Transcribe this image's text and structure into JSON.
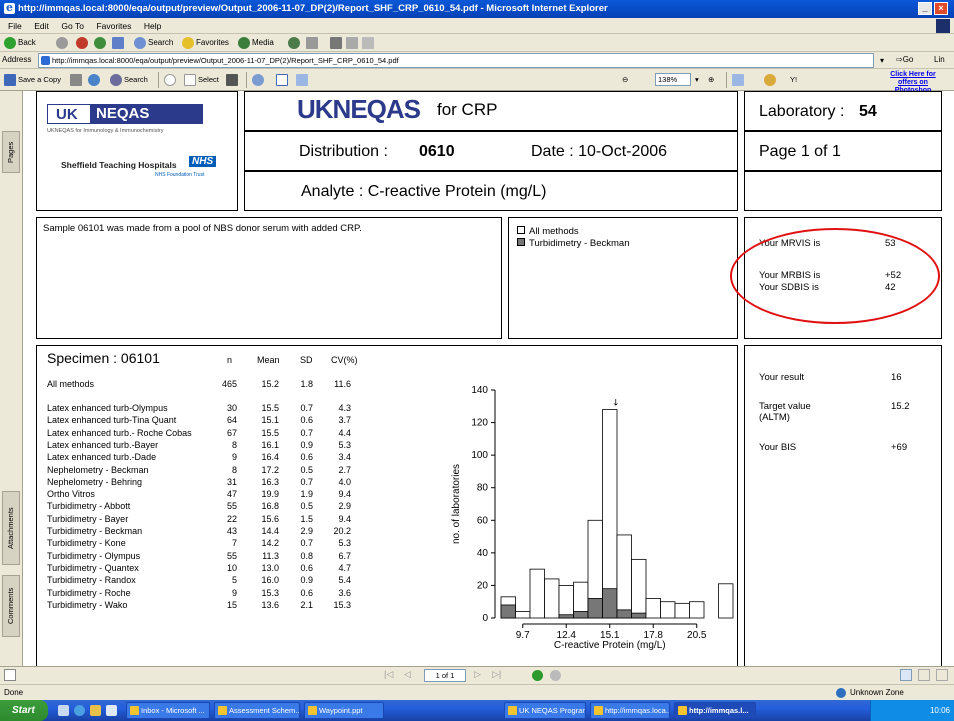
{
  "window": {
    "title": "http://immqas.local:8000/eqa/output/preview/Output_2006-11-07_DP(2)/Report_SHF_CRP_0610_54.pdf - Microsoft Internet Explorer",
    "minimize": "_",
    "close": "×"
  },
  "menu": [
    "File",
    "Edit",
    "Go To",
    "Favorites",
    "Help"
  ],
  "toolbar": {
    "back": "Back",
    "search": "Search",
    "favorites": "Favorites",
    "media": "Media"
  },
  "address": {
    "label": "Address",
    "url": "http://immqas.local:8000/eqa/output/preview/Output_2006-11-07_DP(2)/Report_SHF_CRP_0610_54.pdf",
    "go": "Go",
    "links": "Lin"
  },
  "acrobat": {
    "save_copy": "Save a Copy",
    "search": "Search",
    "select": "Select",
    "zoom": "138%",
    "ad": "Click Here for offers on Photoshop"
  },
  "side_tabs": [
    "Pages",
    "Attachments",
    "Comments"
  ],
  "report": {
    "logo_uk": "UK",
    "logo_neqas": "NEQAS",
    "logo_sub": "UKNEQAS for Immunology & Immunochemistry",
    "hospital": "Sheffield Teaching Hospitals",
    "nhs": "NHS",
    "trust": "NHS Foundation Trust",
    "banner": "UKNEQAS",
    "banner_suffix": "for CRP",
    "laboratory_label": "Laboratory :",
    "laboratory_value": "54",
    "distribution_label": "Distribution :",
    "distribution_value": "0610",
    "date": "Date : 10-Oct-2006",
    "page": "Page 1 of 1",
    "analyte": "Analyte : C-reactive Protein (mg/L)",
    "sample_note": "Sample 06101 was made from a pool of NBS donor serum with added CRP.",
    "legend_all": "All methods",
    "legend_method": "Turbidimetry - Beckman",
    "mrvis_label": "Your MRVIS is",
    "mrvis_value": "53",
    "mrbis_label": "Your MRBIS is",
    "mrbis_value": "+52",
    "sdbis_label": "Your SDBIS is",
    "sdbis_value": "42",
    "specimen": "Specimen : 06101",
    "headers": [
      "n",
      "Mean",
      "SD",
      "CV(%)"
    ],
    "summary_row": {
      "method": "All methods",
      "n": "465",
      "mean": "15.2",
      "sd": "1.8",
      "cv": "11.6"
    },
    "rows": [
      {
        "method": "Latex enhanced turb-Olympus",
        "n": "30",
        "mean": "15.5",
        "sd": "0.7",
        "cv": "4.3"
      },
      {
        "method": "Latex enhanced turb-Tina Quant",
        "n": "64",
        "mean": "15.1",
        "sd": "0.6",
        "cv": "3.7"
      },
      {
        "method": "Latex enhanced turb.- Roche Cobas",
        "n": "67",
        "mean": "15.5",
        "sd": "0.7",
        "cv": "4.4"
      },
      {
        "method": "Latex enhanced turb.-Bayer",
        "n": "8",
        "mean": "16.1",
        "sd": "0.9",
        "cv": "5.3"
      },
      {
        "method": "Latex enhanced turb.-Dade",
        "n": "9",
        "mean": "16.4",
        "sd": "0.6",
        "cv": "3.4"
      },
      {
        "method": "Nephelometry - Beckman",
        "n": "8",
        "mean": "17.2",
        "sd": "0.5",
        "cv": "2.7"
      },
      {
        "method": "Nephelometry - Behring",
        "n": "31",
        "mean": "16.3",
        "sd": "0.7",
        "cv": "4.0"
      },
      {
        "method": "Ortho Vitros",
        "n": "47",
        "mean": "19.9",
        "sd": "1.9",
        "cv": "9.4"
      },
      {
        "method": "Turbidimetry - Abbott",
        "n": "55",
        "mean": "16.8",
        "sd": "0.5",
        "cv": "2.9"
      },
      {
        "method": "Turbidimetry - Bayer",
        "n": "22",
        "mean": "15.6",
        "sd": "1.5",
        "cv": "9.4"
      },
      {
        "method": "Turbidimetry - Beckman",
        "n": "43",
        "mean": "14.4",
        "sd": "2.9",
        "cv": "20.2"
      },
      {
        "method": "Turbidimetry - Kone",
        "n": "7",
        "mean": "14.2",
        "sd": "0.7",
        "cv": "5.3"
      },
      {
        "method": "Turbidimetry - Olympus",
        "n": "55",
        "mean": "11.3",
        "sd": "0.8",
        "cv": "6.7"
      },
      {
        "method": "Turbidimetry - Quantex",
        "n": "10",
        "mean": "13.0",
        "sd": "0.6",
        "cv": "4.7"
      },
      {
        "method": "Turbidimetry - Randox",
        "n": "5",
        "mean": "16.0",
        "sd": "0.9",
        "cv": "5.4"
      },
      {
        "method": "Turbidimetry - Roche",
        "n": "9",
        "mean": "15.3",
        "sd": "0.6",
        "cv": "3.6"
      },
      {
        "method": "Turbidimetry - Wako",
        "n": "15",
        "mean": "13.6",
        "sd": "2.1",
        "cv": "15.3"
      }
    ],
    "result_label": "Your result",
    "result_value": "16",
    "target_label": "Target value",
    "target_sub": "(ALTM)",
    "target_value": "15.2",
    "bis_label": "Your BIS",
    "bis_value": "+69"
  },
  "chart_data": {
    "type": "bar",
    "ylabel": "no. of laboratories",
    "xlabel": "C-reactive Protein (mg/L)",
    "ylim": [
      0,
      140
    ],
    "y_ticks": [
      "0",
      "20",
      "40",
      "60",
      "80",
      "100",
      "120",
      "140"
    ],
    "x_tick_labels": [
      "9.7",
      "12.4",
      "15.1",
      "17.8",
      "20.5"
    ],
    "x_tick_values": [
      9.7,
      12.4,
      15.1,
      17.8,
      20.5
    ],
    "bin_starts": [
      8.35,
      9.25,
      10.15,
      11.05,
      11.95,
      12.85,
      13.75,
      14.65,
      15.55,
      16.45,
      17.35,
      18.25,
      19.15,
      20.05,
      21.85
    ],
    "bin_width": 0.9,
    "series": [
      {
        "name": "All methods",
        "values": [
          13,
          4,
          30,
          24,
          20,
          22,
          60,
          128,
          51,
          36,
          12,
          10,
          9,
          10,
          21
        ]
      },
      {
        "name": "Turbidimetry - Beckman",
        "values": [
          8,
          0,
          0,
          0,
          2,
          4,
          12,
          18,
          5,
          3,
          0,
          0,
          0,
          0,
          0
        ]
      }
    ],
    "marker_x": 15.1,
    "marker_label": "↓"
  },
  "pdf_nav": {
    "page": "1 of 1"
  },
  "status": {
    "left": "Done",
    "zone": "Unknown Zone"
  },
  "taskbar": {
    "start": "Start",
    "tasks": [
      "Inbox - Microsoft ...",
      "Assessment Schem...",
      "Waypoint.ppt",
      "UK NEQAS Programme...",
      "http://immqas.loca...",
      "http://immqas.l..."
    ],
    "clock": "10:06"
  }
}
